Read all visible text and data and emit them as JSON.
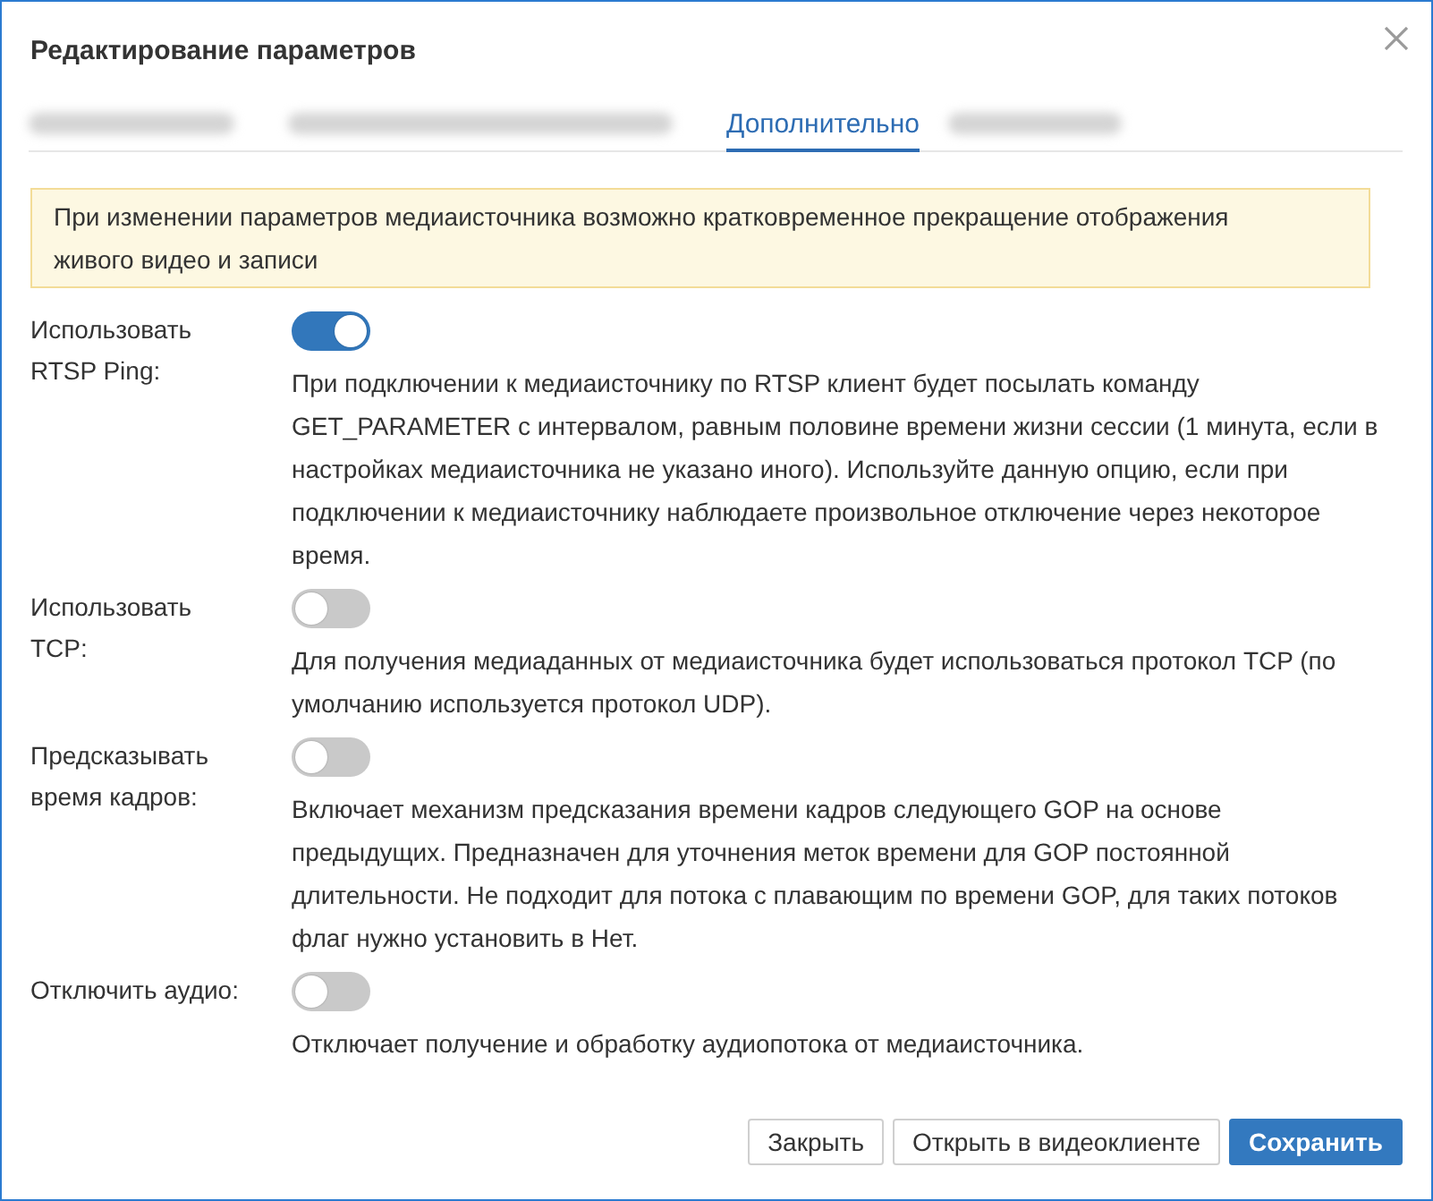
{
  "dialog": {
    "title": "Редактирование параметров"
  },
  "tabs": [
    {
      "blurred": true,
      "selected": false
    },
    {
      "blurred": true,
      "selected": false
    },
    {
      "label": "Дополнительно",
      "selected": true
    },
    {
      "blurred": true,
      "selected": false
    }
  ],
  "notice": "При изменении параметров медиаисточника возможно кратковременное прекращение отображения живого видео и записи",
  "settings": [
    {
      "label": "Использовать RTSP Ping:",
      "on": true,
      "description": "При подключении к медиаисточнику по RTSP клиент будет посылать команду GET_PARAMETER с интервалом, равным половине времени жизни сессии (1 минута, если в настройках медиаисточника не указано иного). Используйте данную опцию, если при подключении к медиаисточнику наблюдаете произвольное отключение через некоторое время."
    },
    {
      "label": "Использовать TCP:",
      "on": false,
      "description": "Для получения медиаданных от медиаисточника будет использоваться протокол TCP (по умолчанию используется протокол UDP)."
    },
    {
      "label": "Предсказывать время кадров:",
      "on": false,
      "description": "Включает механизм предсказания времени кадров следующего GOP на основе предыдущих. Предназначен для уточнения меток времени для GOP постоянной длительности. Не подходит для потока с плавающим по времени GOP, для таких потоков флаг нужно установить в Нет."
    },
    {
      "label": "Отключить аудио:",
      "on": false,
      "description": "Отключает получение и обработку аудиопотока от медиаисточника."
    }
  ],
  "buttons": [
    {
      "label": "Закрыть",
      "kind": "default"
    },
    {
      "label": "Открыть в видеоклиенте",
      "kind": "default"
    },
    {
      "label": "Сохранить",
      "kind": "primary"
    }
  ]
}
